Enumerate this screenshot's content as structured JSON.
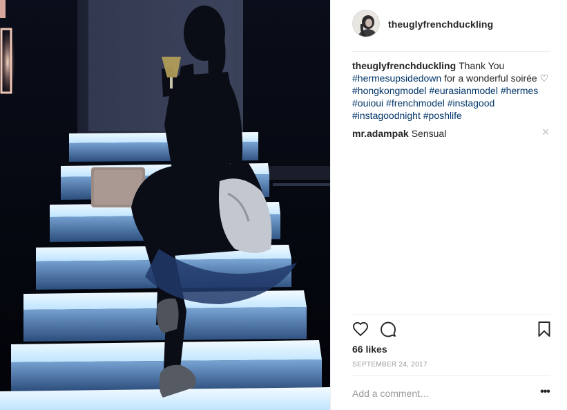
{
  "post": {
    "username": "theuglyfrenchduckling",
    "caption": {
      "author": "theuglyfrenchduckling",
      "text_before": "Thank You ",
      "tag_hermesupsidedown": "#hermesupsidedown",
      "text_after": " for a wonderful soirée ♡",
      "hashtags": [
        "#hongkongmodel",
        "#eurasianmodel",
        "#hermes",
        "#ouioui",
        "#frenchmodel",
        "#instagood",
        "#instagoodnight",
        "#poshlife"
      ]
    },
    "comments": [
      {
        "author": "mr.adampak",
        "text": "Sensual",
        "delete_icon": "close-icon"
      }
    ],
    "likes": "66 likes",
    "date": "SEPTEMBER 24, 2017",
    "add_comment_placeholder": "Add a comment…",
    "more_label": "•••",
    "icons": [
      "heart-icon",
      "comment-icon",
      "bookmark-icon",
      "avatar"
    ]
  },
  "colors": {
    "hashtag": "#003569",
    "text": "#262626",
    "muted": "#999999",
    "divider": "#efefef",
    "photo_bg": "#05070d",
    "step_glow": "#dff1ff"
  }
}
